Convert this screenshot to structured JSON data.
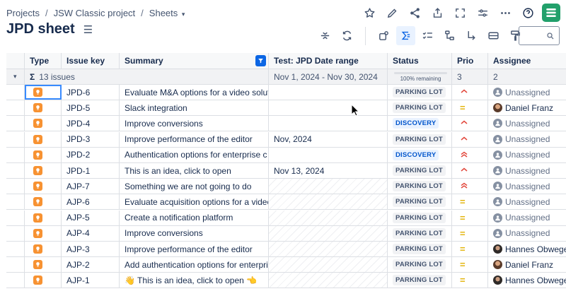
{
  "breadcrumb": {
    "items": [
      "Projects",
      "JSW Classic project",
      "Sheets"
    ],
    "separator": "/"
  },
  "page": {
    "title": "JPD sheet"
  },
  "header_icons": [
    "star-icon",
    "pencil-icon",
    "share-icon",
    "export-icon",
    "fullscreen-icon",
    "filters-icon",
    "more-icon",
    "help-icon",
    "app-logo-icon"
  ],
  "toolbar_icons": [
    "collapse-rows-icon",
    "refresh-icon",
    "group-icon",
    "sum-icon",
    "checklist-icon",
    "hierarchy-icon",
    "hierarchy-down-icon",
    "card-icon",
    "paint-icon"
  ],
  "search": {
    "placeholder": ""
  },
  "columns": [
    "Type",
    "Issue key",
    "Summary",
    "Test: JPD Date range",
    "Status",
    "Prio",
    "Assignee"
  ],
  "summary_row": {
    "symbol": "Σ",
    "count_label": "13 issues",
    "date_range": "Nov 1, 2024 - Nov 30, 2024",
    "progress_label": "100% remaining",
    "prio_count": "3",
    "assignee_count": "2"
  },
  "rows": [
    {
      "key": "JPD-6",
      "summary": "Evaluate M&A options for a video soluti…",
      "date": "",
      "status": "PARKING LOT",
      "prio": "high",
      "assignee": "Unassigned"
    },
    {
      "key": "JPD-5",
      "summary": "Slack integration",
      "date": "",
      "status": "PARKING LOT",
      "prio": "medium",
      "assignee": "Daniel Franz"
    },
    {
      "key": "JPD-4",
      "summary": "Improve conversions",
      "date": "",
      "status": "DISCOVERY",
      "prio": "high",
      "assignee": "Unassigned"
    },
    {
      "key": "JPD-3",
      "summary": "Improve performance of the editor",
      "date": "Nov, 2024",
      "status": "PARKING LOT",
      "prio": "high",
      "assignee": "Unassigned"
    },
    {
      "key": "JPD-2",
      "summary": "Authentication options for enterprise c…",
      "date": "",
      "status": "DISCOVERY",
      "prio": "highest",
      "assignee": "Unassigned"
    },
    {
      "key": "JPD-1",
      "summary": "This is an idea, click to open",
      "date": "Nov 13, 2024",
      "status": "PARKING LOT",
      "prio": "high",
      "assignee": "Unassigned"
    },
    {
      "key": "AJP-7",
      "summary": "Something we are not going to do",
      "date": "",
      "status": "PARKING LOT",
      "prio": "highest",
      "assignee": "Unassigned"
    },
    {
      "key": "AJP-6",
      "summary": "Evaluate acquisition options for a video…",
      "date": "",
      "status": "PARKING LOT",
      "prio": "medium",
      "assignee": "Unassigned"
    },
    {
      "key": "AJP-5",
      "summary": "Create a notification platform",
      "date": "",
      "status": "PARKING LOT",
      "prio": "medium",
      "assignee": "Unassigned"
    },
    {
      "key": "AJP-4",
      "summary": "Improve conversions",
      "date": "",
      "status": "PARKING LOT",
      "prio": "medium",
      "assignee": "Unassigned"
    },
    {
      "key": "AJP-3",
      "summary": "Improve performance of the editor",
      "date": "",
      "status": "PARKING LOT",
      "prio": "medium",
      "assignee": "Hannes Obwege"
    },
    {
      "key": "AJP-2",
      "summary": "Add authentication options for enterpri…",
      "date": "",
      "status": "PARKING LOT",
      "prio": "medium",
      "assignee": "Daniel Franz"
    },
    {
      "key": "AJP-1",
      "summary": "👋 This is an idea, click to open 👈",
      "date": "",
      "status": "PARKING LOT",
      "prio": "medium",
      "assignee": "Hannes Obwege"
    }
  ],
  "colors": {
    "accent": "#0c66e4",
    "idea_orange": "#f79232",
    "prio_high": "#e2483d",
    "prio_medium": "#e2b203",
    "logo_green": "#22a06b"
  }
}
